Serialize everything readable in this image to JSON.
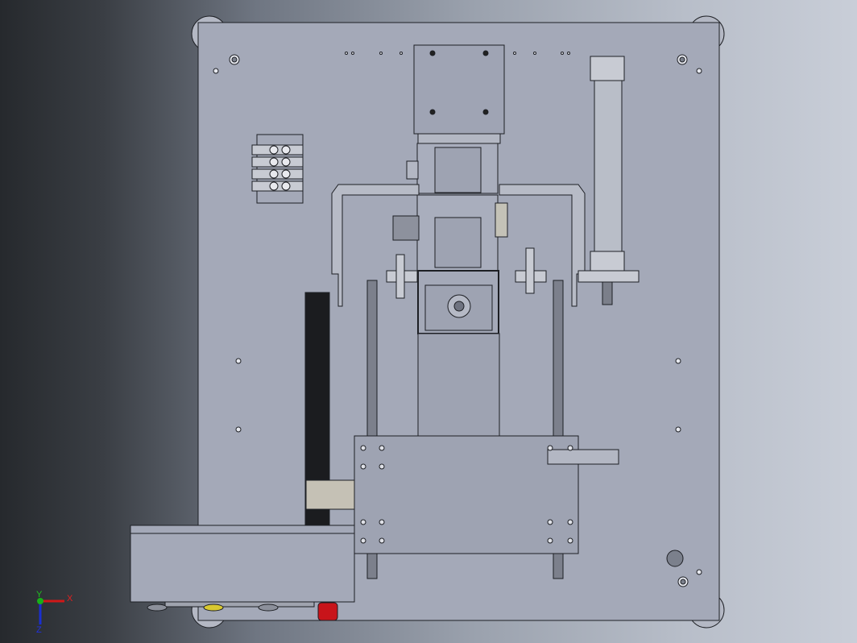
{
  "viewport": {
    "title": "3D model view"
  },
  "triad": {
    "x_label": "X",
    "y_label": "Y",
    "z_label": "Z"
  },
  "colors": {
    "plate": "#a4a9b8",
    "part": "#a9aebd",
    "edge": "#1d1f24",
    "x_axis": "#d01818",
    "y_axis": "#18b018",
    "z_axis": "#1a2fd0",
    "red_button": "#c8141a",
    "yellow_button": "#d8c830"
  }
}
